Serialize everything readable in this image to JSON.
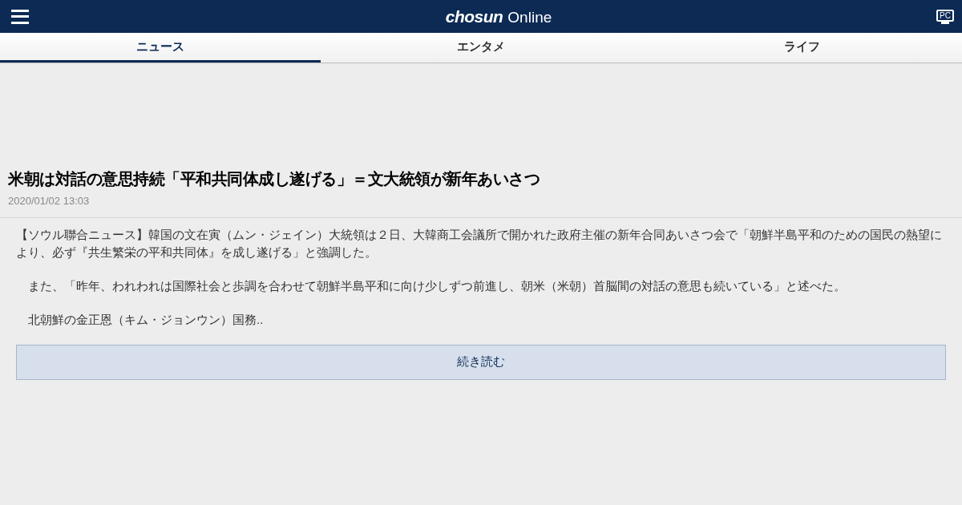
{
  "header": {
    "logo_bold": "chosun",
    "logo_light": "Online",
    "pc_label": "PC"
  },
  "tabs": [
    {
      "label": "ニュース",
      "selected": true
    },
    {
      "label": "エンタメ",
      "selected": false
    },
    {
      "label": "ライフ",
      "selected": false
    }
  ],
  "article": {
    "title": "米朝は対話の意思持続「平和共同体成し遂げる」＝文大統領が新年あいさつ",
    "date": "2020/01/02 13:03",
    "paragraphs": [
      "【ソウル聯合ニュース】韓国の文在寅（ムン・ジェイン）大統領は２日、大韓商工会議所で開かれた政府主催の新年合同あいさつ会で「朝鮮半島平和のための国民の熱望により、必ず『共生繁栄の平和共同体』を成し遂げる」と強調した。",
      "　また、「昨年、われわれは国際社会と歩調を合わせて朝鮮半島平和に向け少しずつ前進し、朝米（米朝）首脳間の対話の意思も続いている」と述べた。",
      "　北朝鮮の金正恩（キム・ジョンウン）国務.."
    ],
    "read_more": "続き読む"
  }
}
